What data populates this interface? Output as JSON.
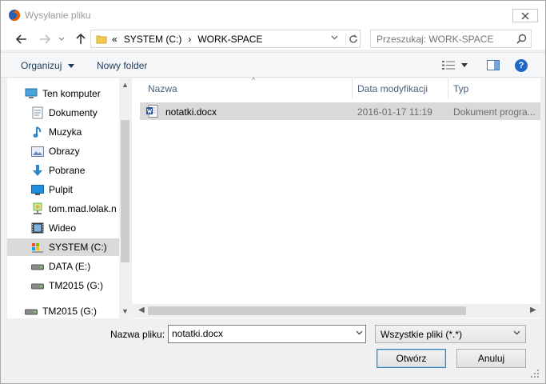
{
  "window": {
    "title": "Wysyłanie pliku"
  },
  "address": {
    "crumbs": [
      "«",
      "SYSTEM (C:)",
      "›",
      "WORK-SPACE"
    ]
  },
  "search": {
    "placeholder": "Przeszukaj: WORK-SPACE"
  },
  "toolbar": {
    "organize_label": "Organizuj",
    "new_folder_label": "Nowy folder"
  },
  "sidebar": {
    "items": [
      {
        "label": "Ten komputer",
        "icon": "computer-icon"
      },
      {
        "label": "Dokumenty",
        "icon": "documents-icon"
      },
      {
        "label": "Muzyka",
        "icon": "music-icon"
      },
      {
        "label": "Obrazy",
        "icon": "pictures-icon"
      },
      {
        "label": "Pobrane",
        "icon": "downloads-icon"
      },
      {
        "label": "Pulpit",
        "icon": "desktop-icon"
      },
      {
        "label": "tom.mad.lolak.n",
        "icon": "network-share-icon"
      },
      {
        "label": "Wideo",
        "icon": "video-icon"
      },
      {
        "label": "SYSTEM (C:)",
        "icon": "system-drive-icon",
        "selected": true
      },
      {
        "label": "DATA (E:)",
        "icon": "drive-icon"
      },
      {
        "label": "TM2015 (G:)",
        "icon": "drive-icon"
      },
      {
        "label": "TM2015 (G:)",
        "icon": "drive-icon"
      }
    ]
  },
  "columns": {
    "name": "Nazwa",
    "modified": "Data modyfikacji",
    "type": "Typ"
  },
  "files": [
    {
      "name": "notatki.docx",
      "modified": "2016-01-17 11:19",
      "type": "Dokument progra...",
      "icon": "word-document-icon"
    }
  ],
  "bottom": {
    "filename_label": "Nazwa pliku:",
    "filename_value": "notatki.docx",
    "filetype_value": "Wszystkie pliki (*.*)",
    "open_label": "Otwórz",
    "cancel_label": "Anuluj"
  },
  "colors": {
    "selection": "#d9d9d9",
    "accent": "#1e67c5",
    "folder": "#f3c94e"
  }
}
